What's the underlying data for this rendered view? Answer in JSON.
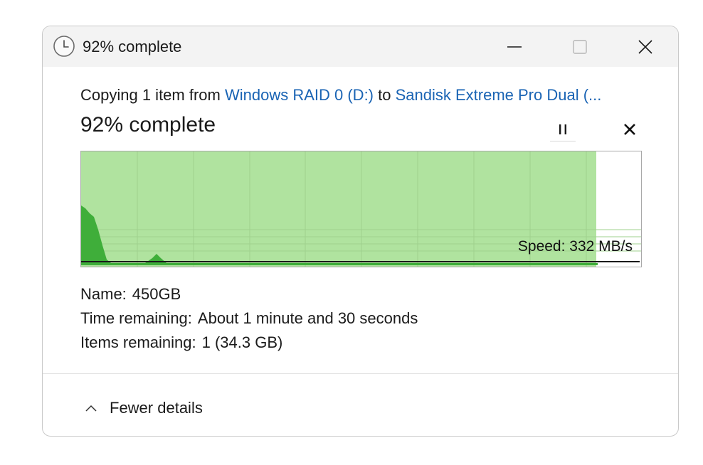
{
  "window": {
    "title": "92% complete",
    "icons": {
      "title": "clock-icon",
      "minimize": "minimize-icon",
      "maximize": "maximize-icon",
      "close": "close-icon"
    }
  },
  "copy": {
    "prefix": "Copying 1 item from ",
    "source": "Windows RAID 0 (D:)",
    "middle": " to ",
    "destination": "Sandisk Extreme Pro Dual (..."
  },
  "progress": {
    "heading": "92% complete",
    "percent": 92,
    "pause_icon": "pause-icon",
    "cancel_icon": "cancel-icon",
    "speed_label": "Speed: 332 MB/s",
    "fill_color": "#b0e39f",
    "series_color": "#3fae3a"
  },
  "details": {
    "name_label": "Name:",
    "name_value": "450GB",
    "time_label": "Time remaining:",
    "time_value": "About 1 minute and 30 seconds",
    "items_label": "Items remaining:",
    "items_value": "1 (34.3 GB)"
  },
  "footer": {
    "toggle_label": "Fewer details",
    "toggle_icon": "chevron-up-icon"
  },
  "colors": {
    "link": "#1a64b4",
    "titlebar": "#f3f3f3"
  }
}
